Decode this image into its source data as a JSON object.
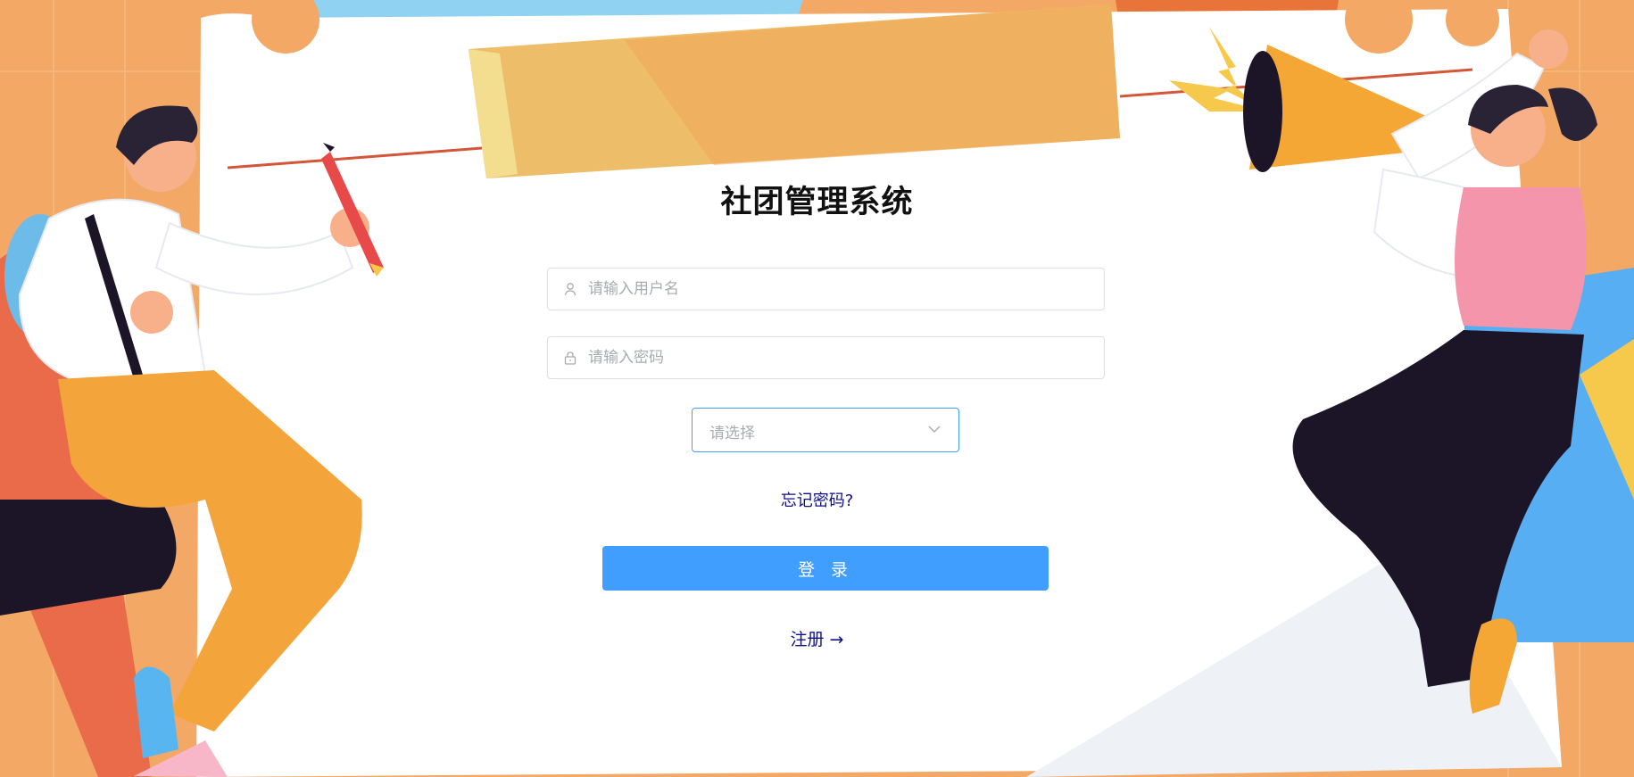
{
  "page": {
    "title": "社团管理系统"
  },
  "form": {
    "username_placeholder": "请输入用户名",
    "username_value": "",
    "password_placeholder": "请输入密码",
    "password_value": "",
    "role_select_placeholder": "请选择",
    "forgot_password_label": "忘记密码?",
    "login_button_label": "登 录",
    "register_link_label": "注册 →"
  },
  "icons": {
    "username": "user-icon",
    "password": "lock-icon",
    "select": "chevron-down-icon"
  },
  "colors": {
    "primary": "#409eff",
    "link": "#10108a",
    "background_orange": "#f3a865"
  }
}
